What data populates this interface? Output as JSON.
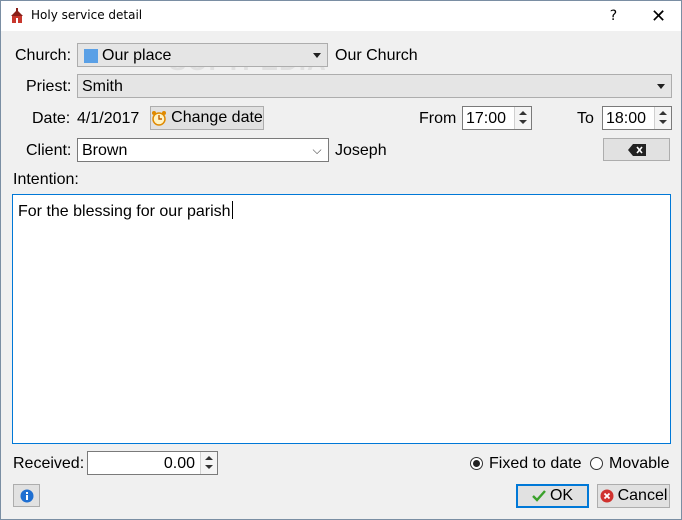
{
  "window": {
    "title": "Holy service detail",
    "help_label": "?",
    "close_label": "✕"
  },
  "church": {
    "label": "Church:",
    "selected": "Our place",
    "name": "Our Church"
  },
  "priest": {
    "label": "Priest:",
    "selected": "Smith"
  },
  "date": {
    "label": "Date:",
    "value": "4/1/2017",
    "change_label": "Change date"
  },
  "time": {
    "from_label": "From",
    "from_value": "17:00",
    "to_label": "To",
    "to_value": "18:00"
  },
  "client": {
    "label": "Client:",
    "value": "Brown",
    "first_name": "Joseph"
  },
  "intention": {
    "label": "Intention:",
    "text": "For the blessing for our parish"
  },
  "received": {
    "label": "Received:",
    "value": "0.00"
  },
  "mode": {
    "fixed_label": "Fixed to date",
    "movable_label": "Movable",
    "selected": "fixed"
  },
  "buttons": {
    "ok_label": "OK",
    "cancel_label": "Cancel"
  },
  "watermark": "SOFTPEDIA",
  "colors": {
    "accent": "#0078d7",
    "ok_check": "#3aa12b",
    "cancel_red": "#d0322f",
    "info_blue": "#1f6fd1"
  }
}
